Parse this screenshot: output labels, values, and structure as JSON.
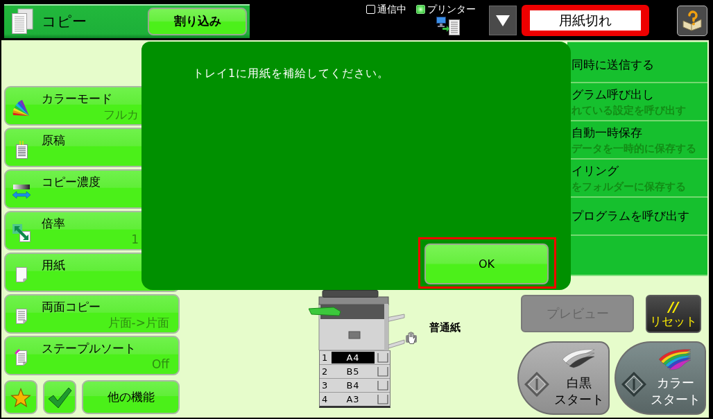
{
  "header": {
    "title": "コピー",
    "interrupt_button": "割り込み"
  },
  "status": {
    "indicators": [
      {
        "label": "通信中",
        "on": false
      },
      {
        "label": "プリンター",
        "on": true
      }
    ],
    "message": "用紙切れ"
  },
  "settings": [
    {
      "label": "カラーモード",
      "value": "フルカ"
    },
    {
      "label": "原稿"
    },
    {
      "label": "コピー濃度"
    },
    {
      "label": "倍率",
      "value": "1"
    },
    {
      "label": "用紙"
    },
    {
      "label": "両面コピー",
      "value": "片面->片面"
    },
    {
      "label": "ステープルソート",
      "value": "Off"
    }
  ],
  "more_functions_button": "他の機能",
  "dialog": {
    "message": "トレイ1に用紙を補給してください。",
    "button": {
      "label": "OK",
      "focused": true
    }
  },
  "right_menu": [
    {
      "title": "同時に送信する"
    },
    {
      "title": "グラム呼び出し",
      "subtitle": "れている設定を呼び出す"
    },
    {
      "title": "自動一時保存",
      "subtitle": "データを一時的に保存する"
    },
    {
      "title": "イリング",
      "subtitle": "をフォルダーに保存する"
    },
    {
      "title": "プログラムを呼び出す"
    }
  ],
  "machine": {
    "trays": [
      {
        "number": "1",
        "size": "A4",
        "selected": true
      },
      {
        "number": "2",
        "size": "B5",
        "selected": false
      },
      {
        "number": "3",
        "size": "B4",
        "selected": false
      },
      {
        "number": "4",
        "size": "A3",
        "selected": false
      }
    ],
    "paper_type": "普通紙"
  },
  "actions": {
    "preview": {
      "label": "プレビュー",
      "disabled": true
    },
    "reset": {
      "mark": "//",
      "label": "リセット"
    },
    "start_buttons": [
      {
        "kind": "mono",
        "lines": [
          "白黒",
          "スタート"
        ]
      },
      {
        "kind": "color",
        "lines": [
          "カラー",
          "スタート"
        ]
      }
    ]
  }
}
